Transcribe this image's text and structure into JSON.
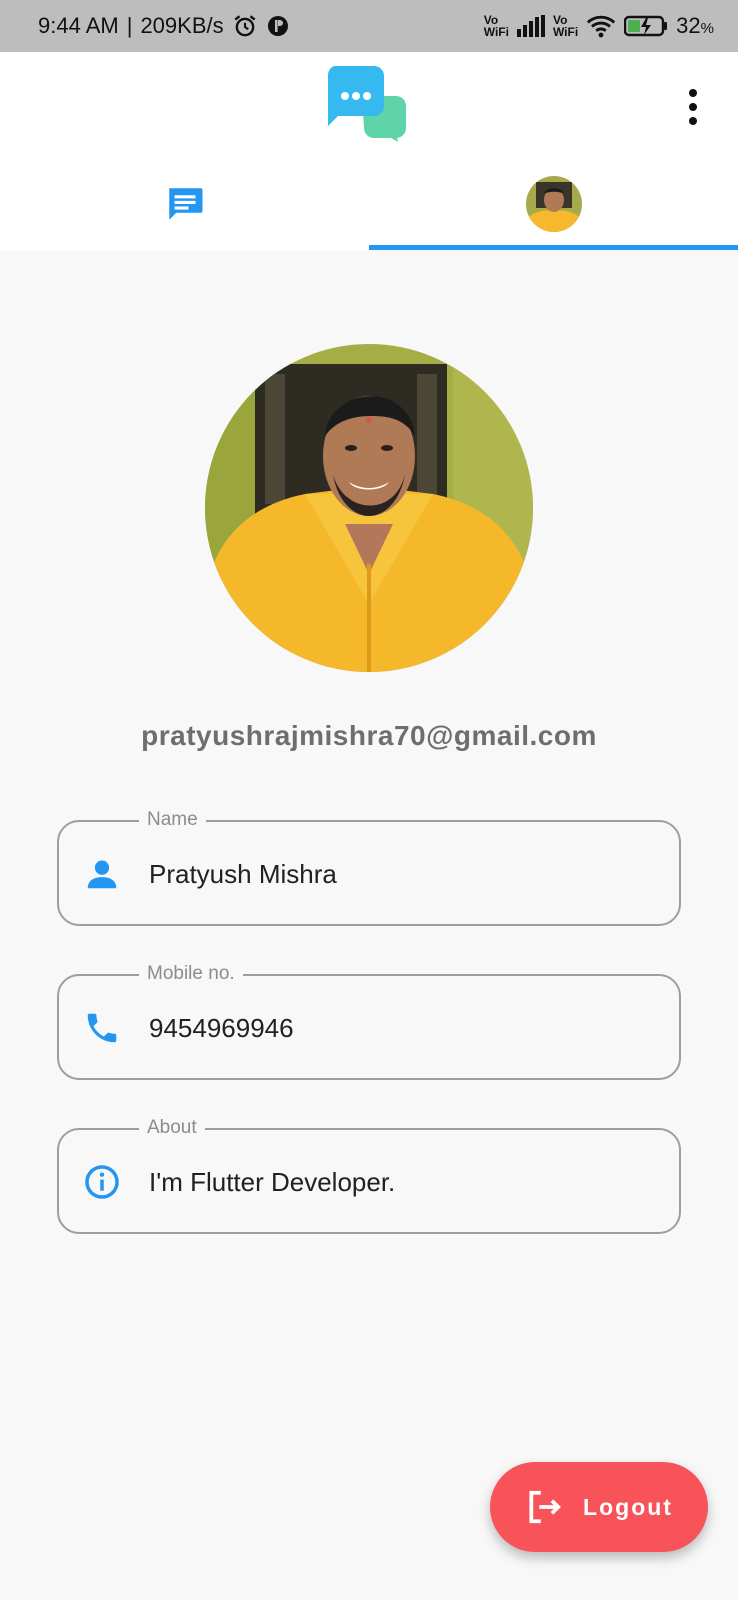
{
  "status_bar": {
    "time": "9:44 AM",
    "network_speed": "209KB/s",
    "vowifi_1": "Vo WiFi",
    "vowifi_2": "Vo WiFi",
    "battery": "32",
    "battery_unit": "%",
    "icons": [
      "alarm-icon",
      "app-notification-icon",
      "signal-icon",
      "wifi-icon",
      "battery-charging-icon"
    ]
  },
  "app_bar": {
    "logo": "chat-bubbles-logo",
    "menu_icon": "more-vertical-icon"
  },
  "tabs": [
    {
      "icon": "chat-icon",
      "selected": false
    },
    {
      "icon": "profile-avatar",
      "selected": true
    }
  ],
  "profile": {
    "email": "pratyushrajmishra70@gmail.com",
    "fields": [
      {
        "label": "Name",
        "value": "Pratyush Mishra",
        "icon": "person-icon"
      },
      {
        "label": "Mobile no.",
        "value": "9454969946",
        "icon": "phone-icon"
      },
      {
        "label": "About",
        "value": "I'm Flutter Developer.",
        "icon": "info-icon"
      }
    ]
  },
  "logout": {
    "label": "Logout",
    "icon": "logout-icon"
  },
  "colors": {
    "accent": "#2196f3",
    "logout": "#f75358",
    "status_bar": "#bdbdbd",
    "background": "#f8f8f8"
  }
}
